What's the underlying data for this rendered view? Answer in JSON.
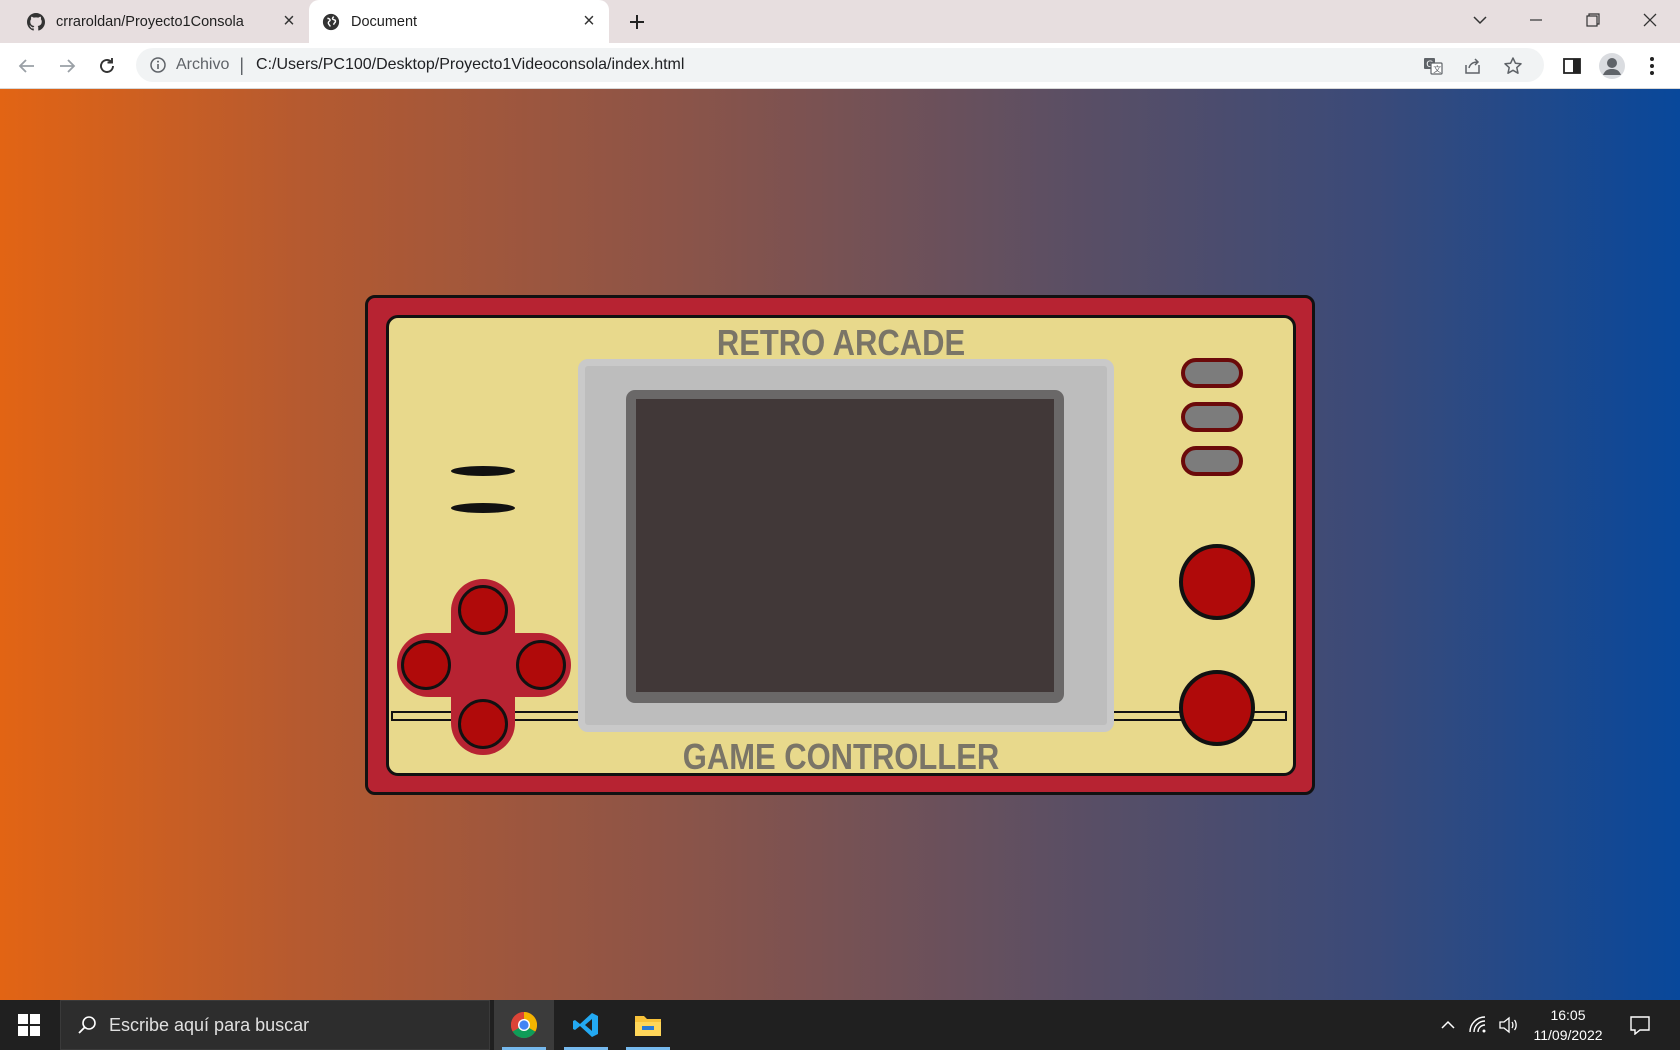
{
  "browser": {
    "tabs": [
      {
        "title": "crraroldan/Proyecto1Consola",
        "icon": "github-icon",
        "active": false
      },
      {
        "title": "Document",
        "icon": "globe-icon",
        "active": true
      }
    ],
    "address": {
      "scheme_label": "Archivo",
      "separator": "|",
      "url": "C:/Users/PC100/Desktop/Proyecto1Videoconsola/index.html"
    }
  },
  "page": {
    "background_gradient": [
      "#e26414",
      "#08489b"
    ],
    "console": {
      "title_top": "RETRO ARCADE",
      "title_bottom": "GAME CONTROLLER",
      "body_color": "#b72332",
      "face_color": "#e8d98c",
      "screen_color": "#413838",
      "button_color": "#b00a0a"
    }
  },
  "taskbar": {
    "search_placeholder": "Escribe aquí para buscar",
    "apps": [
      "chrome-icon",
      "vscode-icon",
      "file-explorer-icon"
    ],
    "time": "16:05",
    "date": "11/09/2022"
  }
}
